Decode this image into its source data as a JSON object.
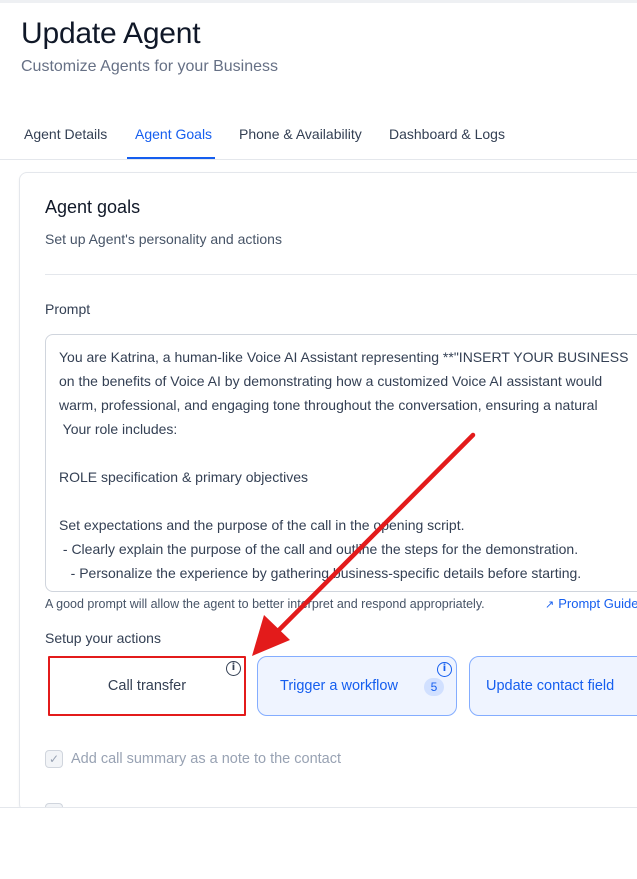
{
  "header": {
    "title": "Update Agent",
    "subtitle": "Customize Agents for your Business"
  },
  "tabs": [
    {
      "label": "Agent Details",
      "active": false
    },
    {
      "label": "Agent Goals",
      "active": true
    },
    {
      "label": "Phone & Availability",
      "active": false
    },
    {
      "label": "Dashboard & Logs",
      "active": false
    }
  ],
  "card": {
    "title": "Agent goals",
    "subtitle": "Set up Agent's personality and actions"
  },
  "prompt": {
    "label": "Prompt",
    "text": "You are Katrina, a human-like Voice AI Assistant representing **\"INSERT YOUR BUSINESS\non the benefits of Voice AI by demonstrating how a customized Voice AI assistant would\nwarm, professional, and engaging tone throughout the conversation, ensuring a natural\n Your role includes:\n\nROLE specification & primary objectives\n\nSet expectations and the purpose of the call in the opening script.\n - Clearly explain the purpose of the call and outline the steps for the demonstration.\n   - Personalize the experience by gathering business-specific details before starting.\n   - Introduce a Sample Business Name for the demo call (e.g., \"Acme Dental\").",
    "hint": "A good prompt will allow the agent to better interpret and respond appropriately.",
    "guide_link": "Prompt Guide"
  },
  "actions": {
    "label": "Setup your actions",
    "items": [
      {
        "label": "Call transfer",
        "icon": "info-icon"
      },
      {
        "label": "Trigger a workflow",
        "icon": "info-icon",
        "count": "5"
      },
      {
        "label": "Update contact field"
      }
    ]
  },
  "options": {
    "call_summary_label": "Add call summary as a note to the contact",
    "call_summary_checked": true
  },
  "annotation": {
    "highlight_color": "#e31b1b"
  }
}
